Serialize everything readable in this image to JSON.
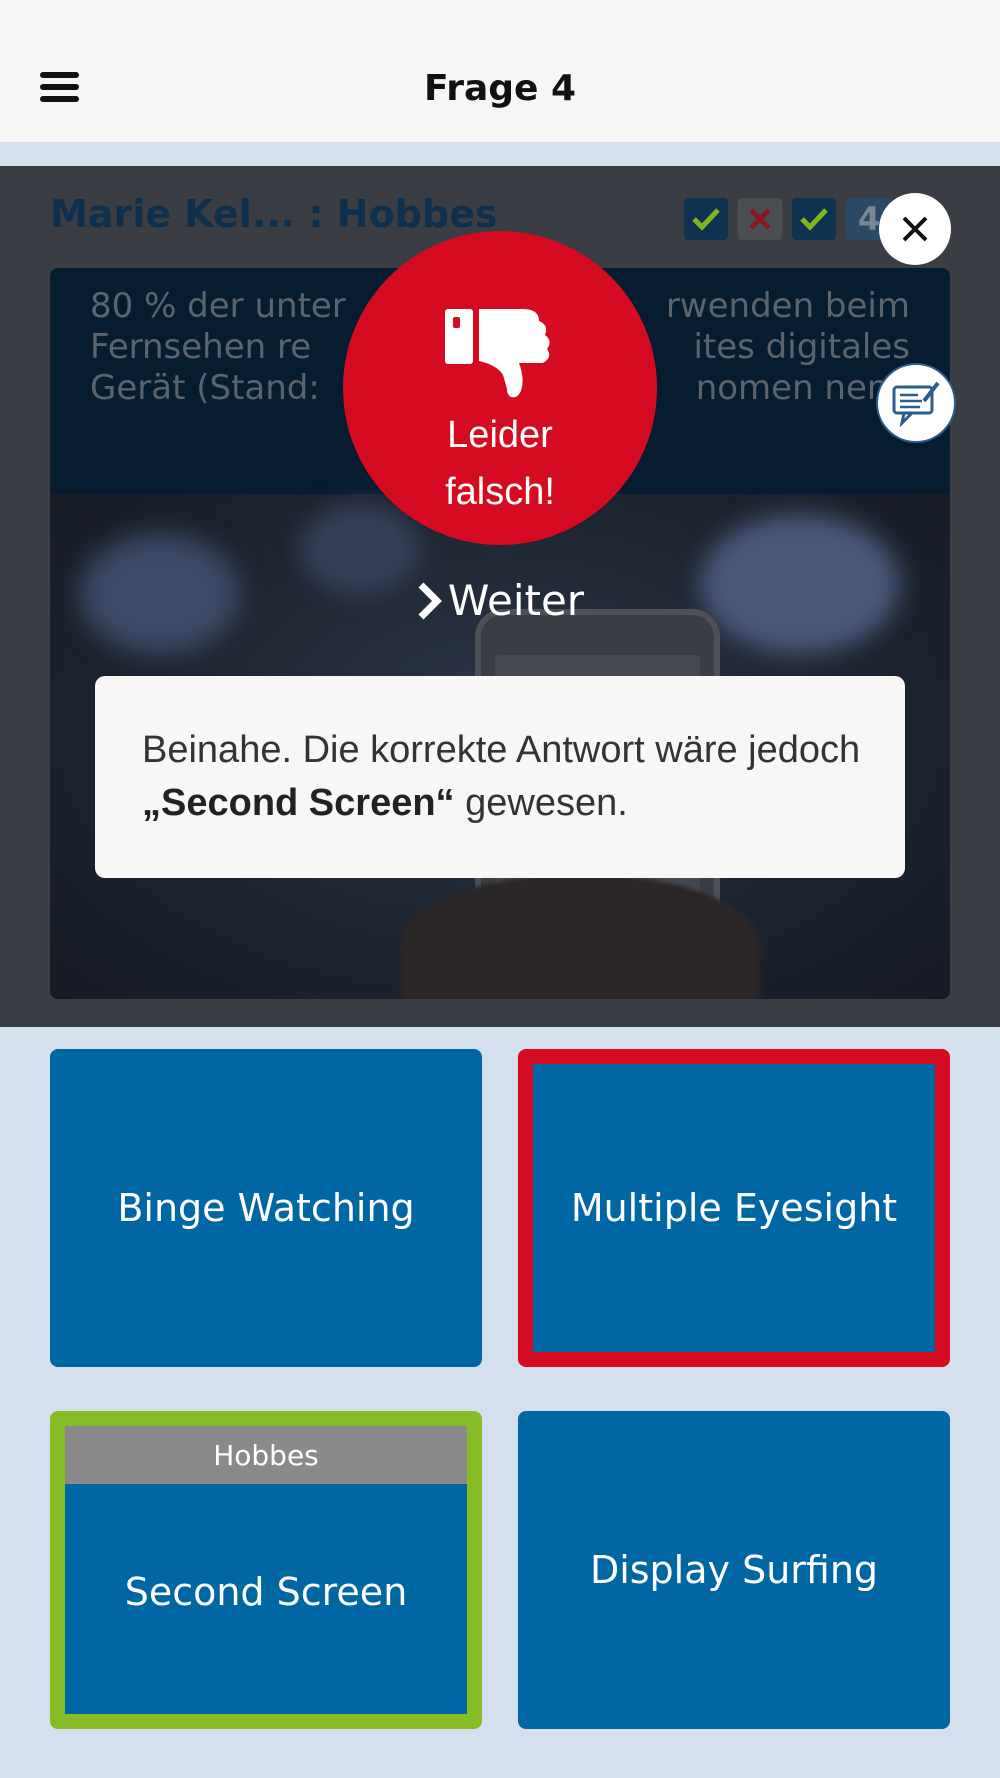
{
  "header": {
    "title": "Frage 4",
    "menu_icon": "hamburger-menu-icon"
  },
  "matchup": {
    "title": "Marie Kel... : Hobbes"
  },
  "progress": [
    {
      "status": "correct",
      "icon": "check-icon"
    },
    {
      "status": "wrong",
      "icon": "cross-icon"
    },
    {
      "status": "correct",
      "icon": "check-icon"
    },
    {
      "status": "current",
      "label": "4"
    }
  ],
  "question": {
    "line1": "80 % der unter",
    "line1b": "rwenden beim",
    "line2": "Fernsehen re",
    "line2b": "ites digitales",
    "line3": "Gerät (Stand:",
    "line3b": "nomen nenn"
  },
  "result": {
    "icon": "thumbs-down-icon",
    "line1": "Leider",
    "line2": "falsch!",
    "color": "#d50c21"
  },
  "close_icon": "close-icon",
  "note_icon": "comment-note-icon",
  "weiter": {
    "label": "Weiter",
    "icon": "chevron-right-icon"
  },
  "feedback": {
    "prefix": "Beinahe. Die korrekte Antwort wäre jedoch ",
    "answer": "„Second Screen“",
    "suffix": " gewesen."
  },
  "answers": [
    {
      "label": "Binge Watching",
      "state": "neutral"
    },
    {
      "label": "Multiple Eyesight",
      "state": "wrong"
    },
    {
      "label": "Second Screen",
      "state": "correct",
      "tag": "Hobbes"
    },
    {
      "label": "Display Surfing",
      "state": "neutral"
    }
  ],
  "colors": {
    "answer_blue": "#0066a4",
    "correct_green": "#86bc25",
    "wrong_red": "#d50c21"
  }
}
